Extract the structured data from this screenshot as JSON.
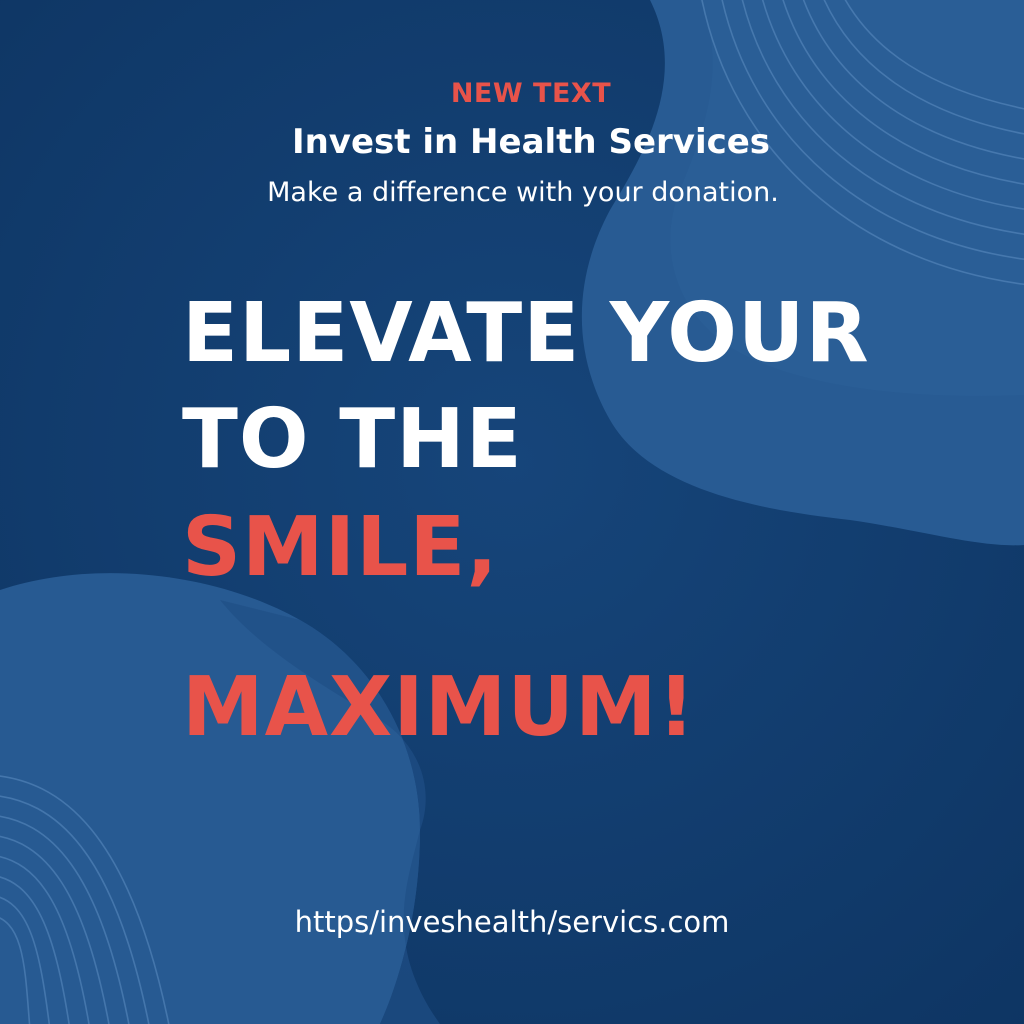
{
  "poster": {
    "eyebrow": "NEW TEXT",
    "title": "Invest in Health Services",
    "subtitle": "Make a difference with your donation.",
    "headline": {
      "line1": "ELEVATE YOUR",
      "line2": "TO THE",
      "line3": "SMILE,",
      "line4": "MAXIMUM!"
    },
    "url": "https/inveshealth/servics.com"
  },
  "colors": {
    "background": "#113b6c",
    "blob": "#2a5f97",
    "accent": "#e8534a",
    "text": "#ffffff"
  }
}
